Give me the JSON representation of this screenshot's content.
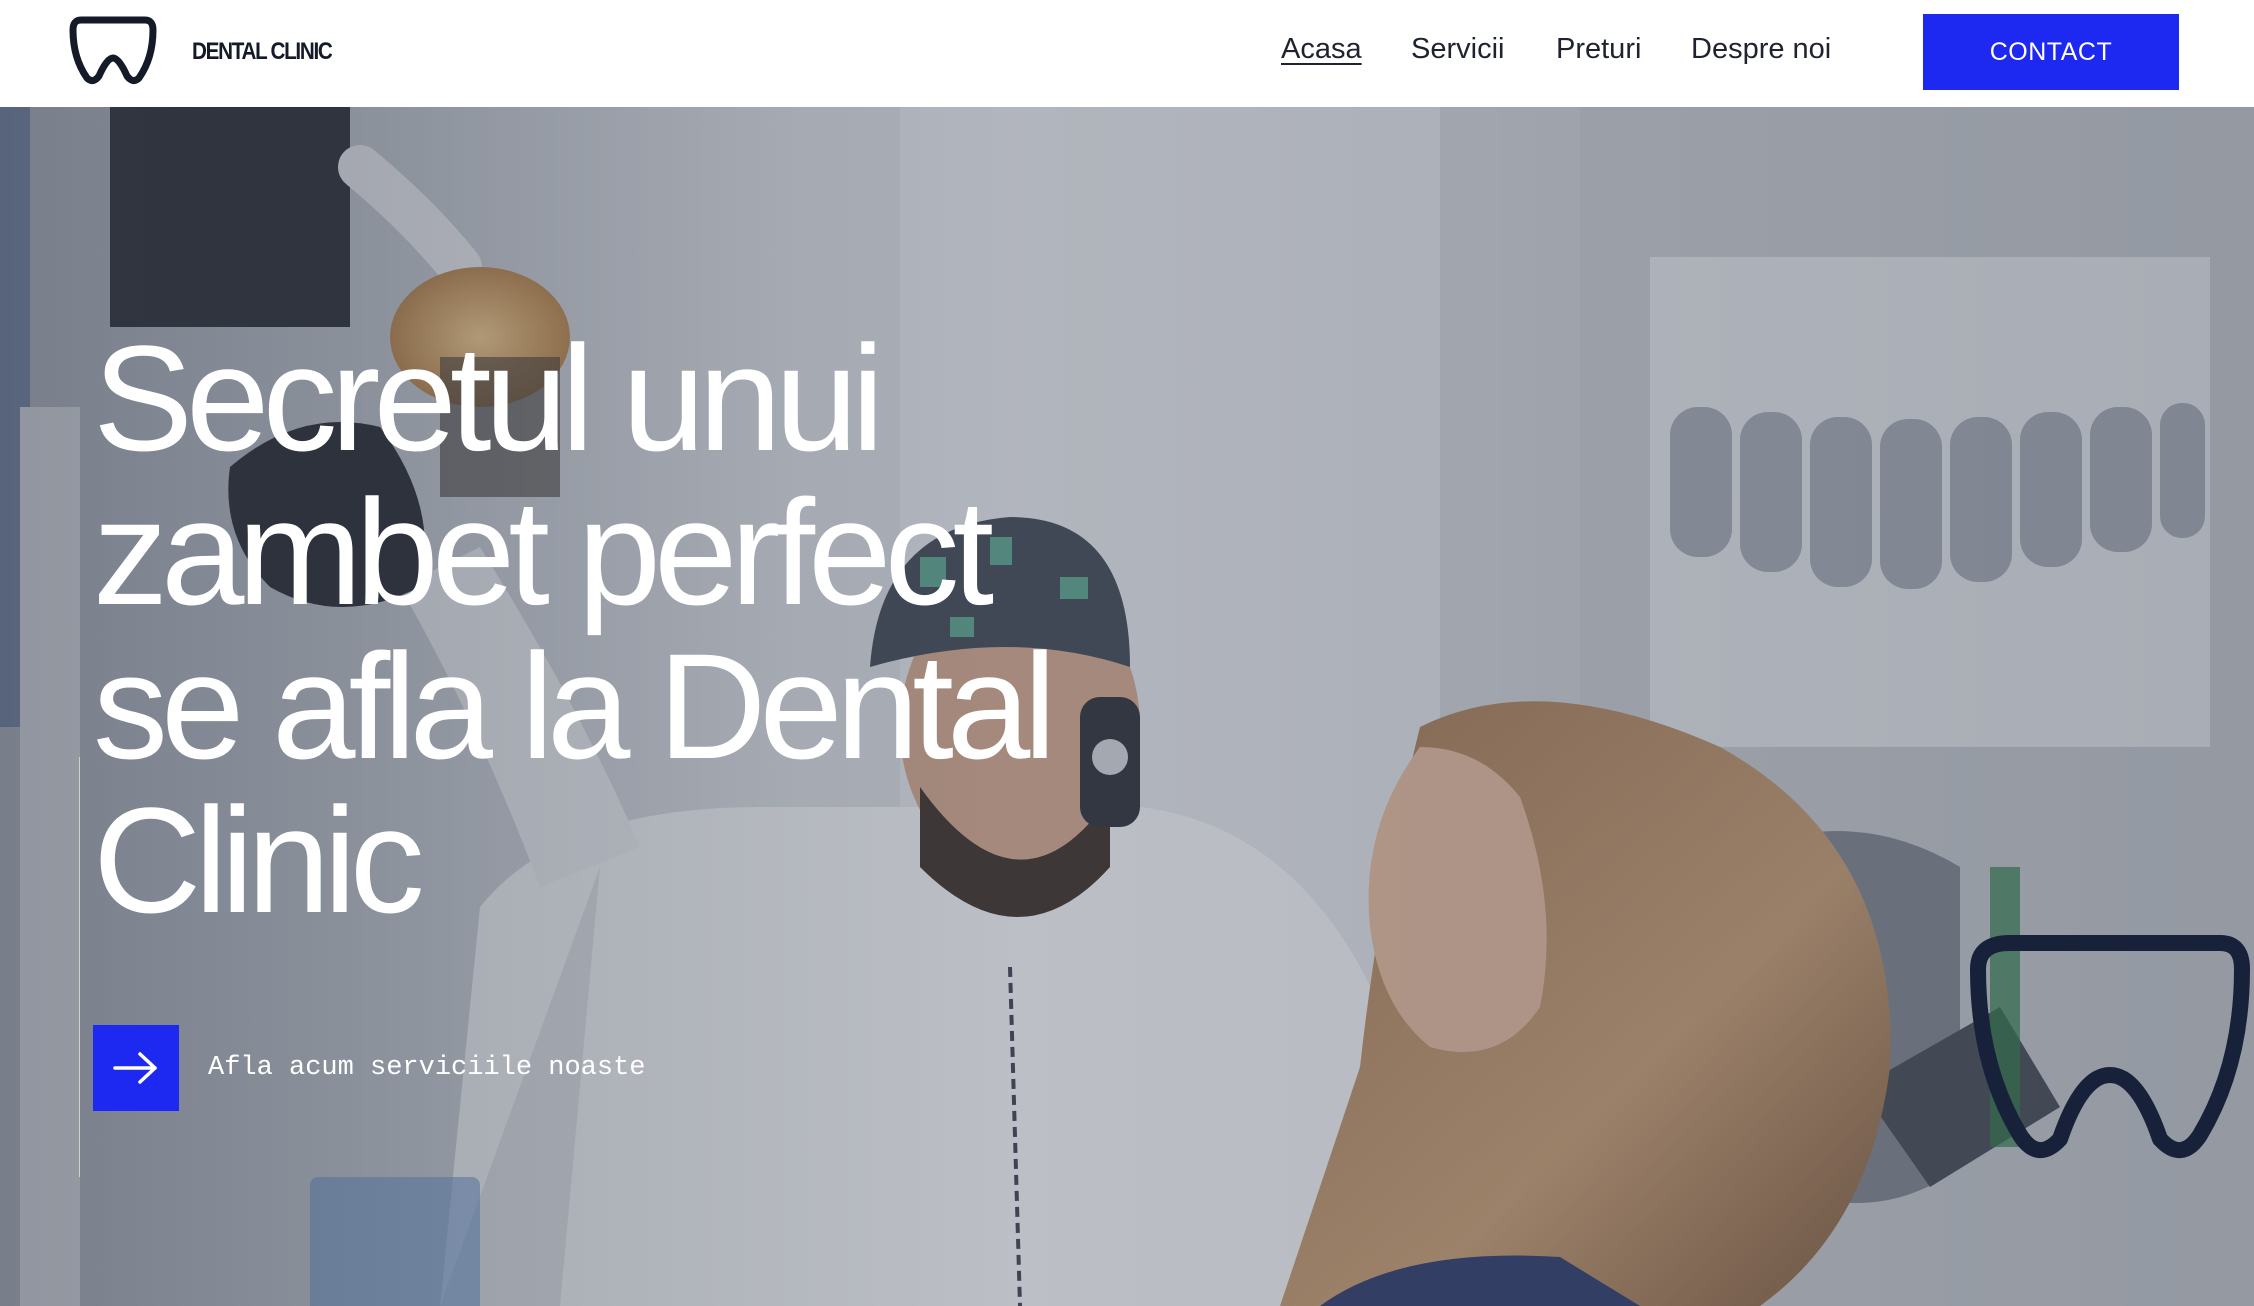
{
  "header": {
    "brand": "DENTAL CLINIC",
    "nav": [
      {
        "label": "Acasa",
        "active": true
      },
      {
        "label": "Servicii",
        "active": false
      },
      {
        "label": "Preturi",
        "active": false
      },
      {
        "label": "Despre noi",
        "active": false
      }
    ],
    "contact_label": "CONTACT"
  },
  "hero": {
    "title_lines": [
      "Secretul unui",
      "zambet perfect",
      "se afla la Dental",
      "Clinic"
    ],
    "cta_label": "Afla acum serviciile noaste"
  },
  "colors": {
    "accent": "#1d28f0",
    "logo_dark": "#151a28",
    "hero_text": "#ffffff"
  },
  "icons": {
    "logo": "tooth-logo-icon",
    "cta": "arrow-right-icon",
    "decor": "tooth-outline-icon"
  }
}
